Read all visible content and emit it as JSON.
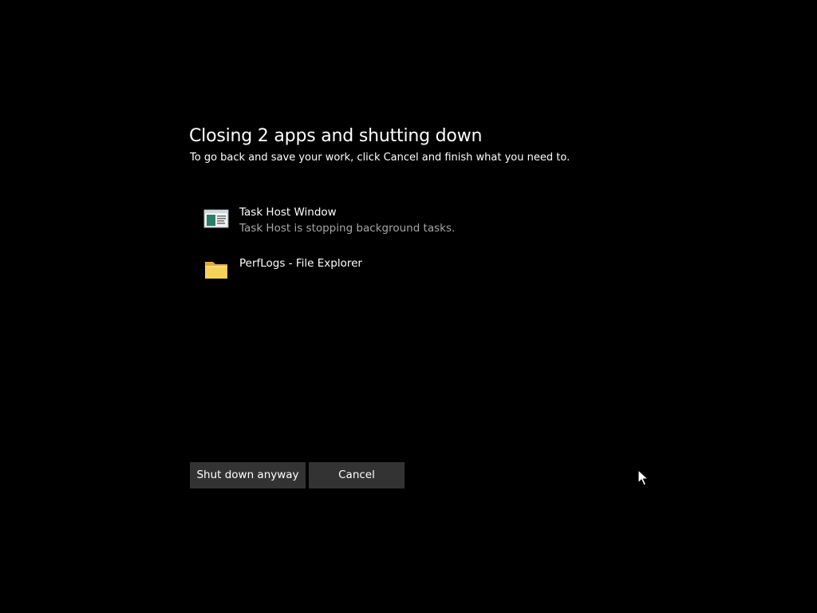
{
  "dialog": {
    "title": "Closing 2 apps and shutting down",
    "subtitle": "To go back and save your work, click Cancel and finish what you need to."
  },
  "apps": [
    {
      "name": "Task Host Window",
      "status": "Task Host is stopping background tasks.",
      "icon": "task-host-window-icon"
    },
    {
      "name": "PerfLogs - File Explorer",
      "status": "",
      "icon": "folder-icon"
    }
  ],
  "buttons": {
    "shutdown_label": "Shut down anyway",
    "cancel_label": "Cancel"
  },
  "colors": {
    "background": "#000000",
    "button_bg": "#333333",
    "secondary_text": "#a6a6a6",
    "folder_yellow": "#f7d05a"
  }
}
